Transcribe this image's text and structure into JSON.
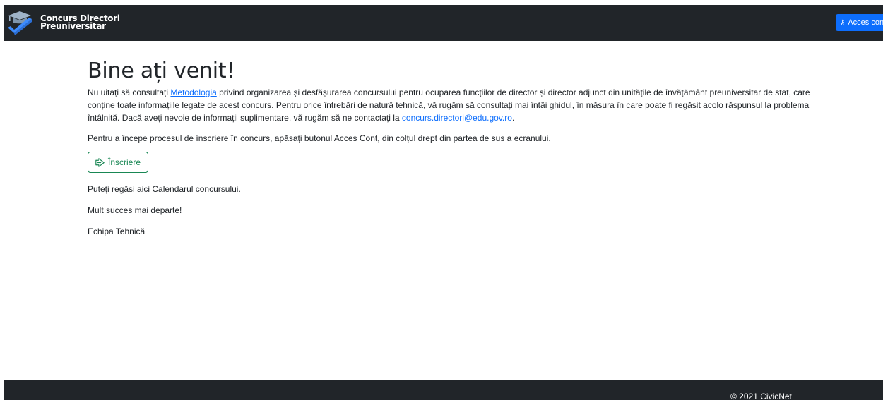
{
  "navbar": {
    "brand_line1": "Concurs Directori",
    "brand_line2": "Preuniversitar",
    "acces_button_label": "Acces cont",
    "logo_icon": "graduation-cap-check-icon",
    "acces_icon": "key-icon"
  },
  "main": {
    "title": "Bine ați venit!",
    "intro_before_link": "Nu uitați să consultați ",
    "intro_link_text": "Metodologia",
    "intro_after_link": " privind organizarea și desfășurarea concursului pentru ocuparea funcțiilor de director și director adjunct din unitățile de învățământ preuniversitar de stat, care conține toate informațiile legate de acest concurs. Pentru orice întrebări de natură tehnică, vă rugăm să consultați mai întâi ghidul, în măsura în care poate fi regăsit acolo răspunsul la problema întâlnită. Dacă aveți nevoie de informații suplimentare, vă rugăm să ne contactați la ",
    "contact_email": "concurs.directori@edu.gov.ro",
    "intro_end": ".",
    "instruction": "Pentru a începe procesul de înscriere în concurs, apăsați butonul Acces Cont, din colțul drept din partea de sus a ecranului.",
    "inscriere_button_label": "Înscriere",
    "inscriere_icon": "sign-in-arrow-icon",
    "calendar_text": "Puteți regăsi aici Calendarul concursului.",
    "closing_text": "Mult succes mai departe!",
    "signature": "Echipa Tehnică"
  },
  "footer": {
    "copyright": "© 2021 CivicNet"
  },
  "colors": {
    "navbar_bg": "#212529",
    "primary": "#0d6efd",
    "success": "#198754",
    "text": "#212529"
  }
}
